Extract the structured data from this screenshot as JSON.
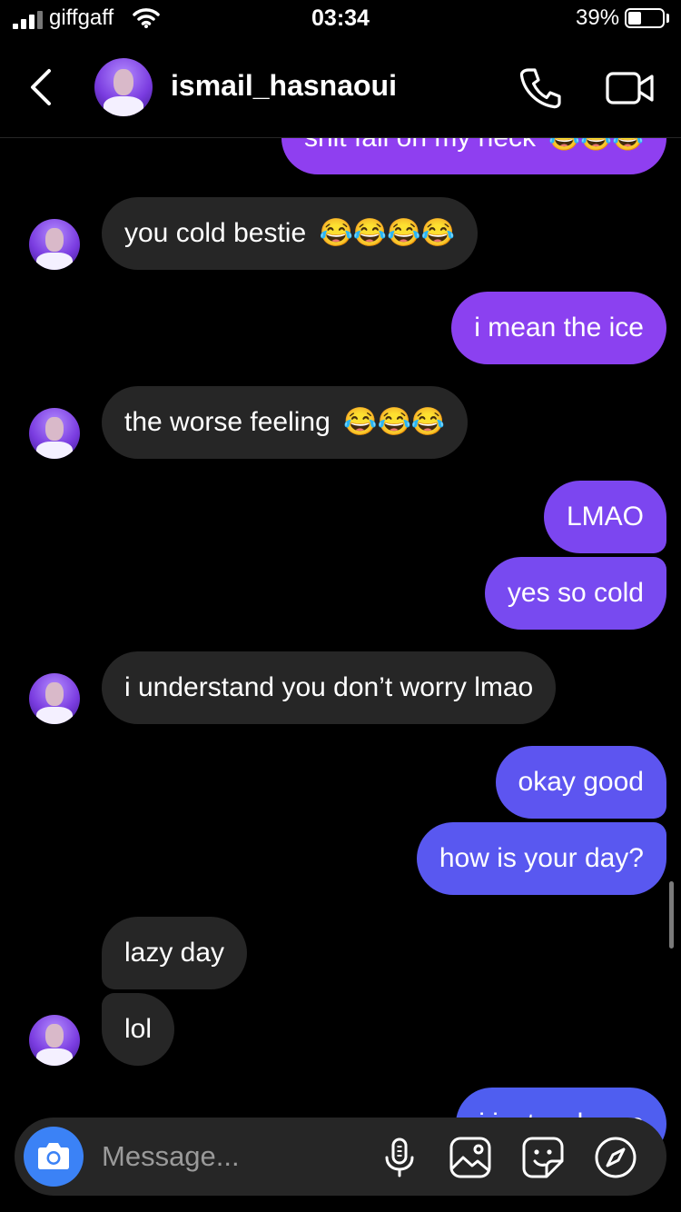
{
  "status_bar": {
    "carrier": "giffgaff",
    "time": "03:34",
    "battery_percent": "39%",
    "icons": [
      "signal-icon",
      "wifi-icon",
      "battery-icon"
    ]
  },
  "header": {
    "username": "ismail_hasnaoui",
    "icons": [
      "back-chevron-icon",
      "phone-icon",
      "video-camera-icon"
    ]
  },
  "messages": [
    {
      "side": "out",
      "text": "shit fall on my neck",
      "emoji": "😂😂😂",
      "partial": true
    },
    {
      "side": "in",
      "text": "you cold bestie",
      "emoji": "😂😂😂😂"
    },
    {
      "side": "out",
      "text": "i mean the ice"
    },
    {
      "side": "in",
      "text": "the worse feeling",
      "emoji": "😂😂😂"
    },
    {
      "side": "out",
      "text": "LMAO"
    },
    {
      "side": "out",
      "text": "yes so cold"
    },
    {
      "side": "in",
      "text": "i understand you don’t worry lmao"
    },
    {
      "side": "out",
      "text": "okay good"
    },
    {
      "side": "out",
      "text": "how is your day?"
    },
    {
      "side": "in",
      "text": "lazy day"
    },
    {
      "side": "in",
      "text": "lol"
    },
    {
      "side": "out",
      "text": "i just woke up",
      "partial": true
    }
  ],
  "composer": {
    "placeholder": "Message...",
    "value": "",
    "icons": [
      "camera-icon",
      "microphone-icon",
      "gallery-icon",
      "sticker-icon",
      "compass-icon"
    ]
  },
  "colors": {
    "background": "#000000",
    "incoming_bubble": "#262626",
    "outgoing_top": "#8f3ff0",
    "outgoing_bottom": "#4f5ef0",
    "camera_button": "#3b82f6"
  }
}
